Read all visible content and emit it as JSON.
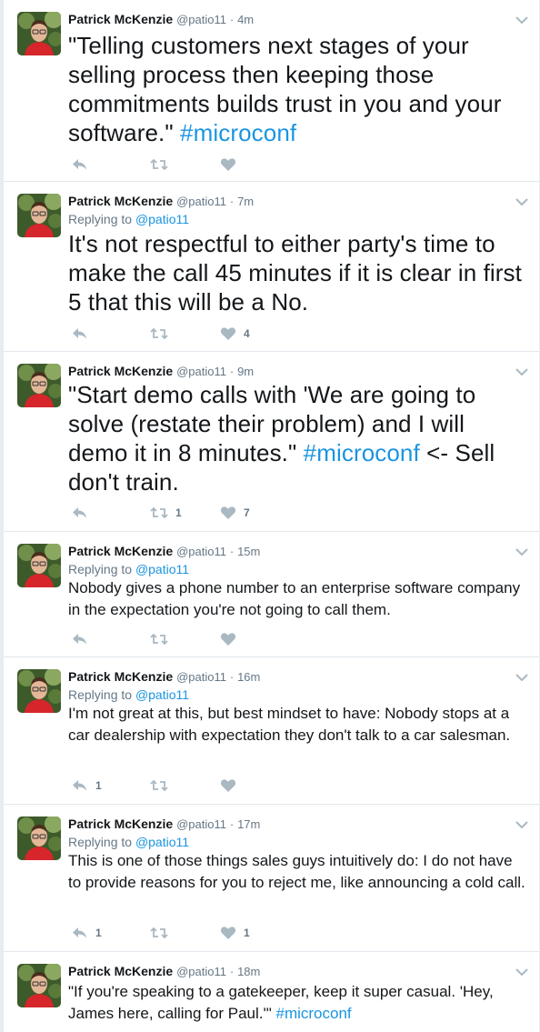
{
  "colors": {
    "link": "#1b95e0",
    "icon": "#aab8c2",
    "meta": "#657786"
  },
  "tweets": [
    {
      "name": "Patrick McKenzie",
      "handle": "@patio11",
      "sep": "·",
      "time": "4m",
      "replying_label": "",
      "replying_handle": "",
      "text_before": "\"Telling customers next stages of your selling process then keeping those commitments builds trust in you and your software.\" ",
      "hashtag": "#microconf",
      "text_after": "",
      "reply_count": "",
      "retweet_count": "",
      "like_count": ""
    },
    {
      "name": "Patrick McKenzie",
      "handle": "@patio11",
      "sep": "·",
      "time": "7m",
      "replying_label": "Replying to ",
      "replying_handle": "@patio11",
      "text_before": "It's not respectful to either party's time to make the call 45 minutes if it is clear in first 5 that this will be a No.",
      "hashtag": "",
      "text_after": "",
      "reply_count": "",
      "retweet_count": "",
      "like_count": "4"
    },
    {
      "name": "Patrick McKenzie",
      "handle": "@patio11",
      "sep": "·",
      "time": "9m",
      "replying_label": "",
      "replying_handle": "",
      "text_before": "\"Start demo calls with 'We are going to solve (restate their problem) and I will demo it in 8 minutes.\" ",
      "hashtag": "#microconf",
      "text_after": " <- Sell don't train.",
      "reply_count": "",
      "retweet_count": "1",
      "like_count": "7"
    },
    {
      "name": "Patrick McKenzie",
      "handle": "@patio11",
      "sep": "·",
      "time": "15m",
      "replying_label": "Replying to ",
      "replying_handle": "@patio11",
      "text_before": "Nobody gives a phone number to an enterprise software company in the expectation you're not going to call them.",
      "hashtag": "",
      "text_after": "",
      "reply_count": "",
      "retweet_count": "",
      "like_count": ""
    },
    {
      "name": "Patrick McKenzie",
      "handle": "@patio11",
      "sep": "·",
      "time": "16m",
      "replying_label": "Replying to ",
      "replying_handle": "@patio11",
      "text_before": "I'm not great at this, but best mindset to have: Nobody stops at a car dealership with expectation they don't talk to a car salesman.",
      "hashtag": "",
      "text_after": "",
      "reply_count": "1",
      "retweet_count": "",
      "like_count": ""
    },
    {
      "name": "Patrick McKenzie",
      "handle": "@patio11",
      "sep": "·",
      "time": "17m",
      "replying_label": "Replying to ",
      "replying_handle": "@patio11",
      "text_before": "This is one of those things sales guys intuitively do: I do not have to provide reasons for you to reject me, like announcing a cold call.",
      "hashtag": "",
      "text_after": "",
      "reply_count": "1",
      "retweet_count": "",
      "like_count": "1"
    },
    {
      "name": "Patrick McKenzie",
      "handle": "@patio11",
      "sep": "·",
      "time": "18m",
      "replying_label": "",
      "replying_handle": "",
      "text_before": "\"If you're speaking to a gatekeeper, keep it super casual. 'Hey, James here, calling for Paul.'\" ",
      "hashtag": "#microconf",
      "text_after": "",
      "reply_count": "",
      "retweet_count": "",
      "like_count": ""
    }
  ]
}
